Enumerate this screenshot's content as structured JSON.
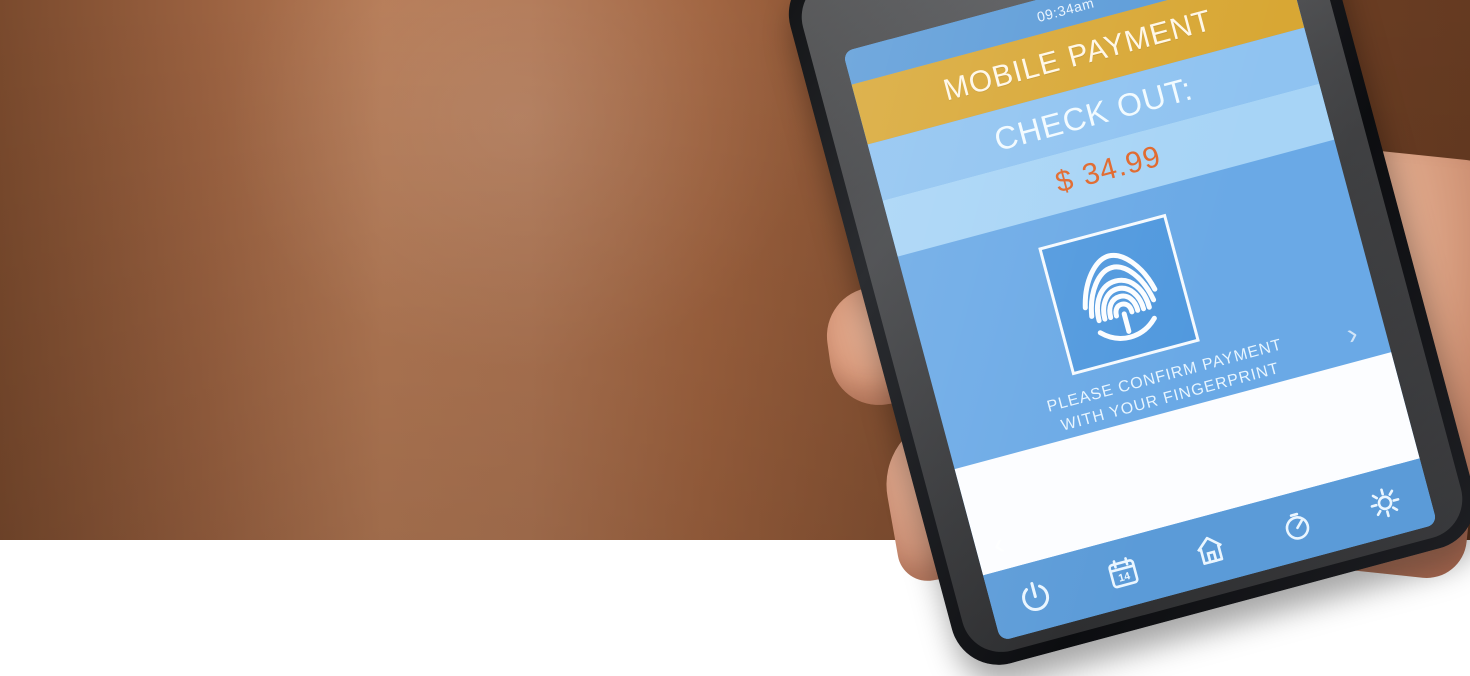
{
  "status": {
    "time": "09:34am"
  },
  "screen": {
    "banner_title": "MOBILE PAYMENT",
    "checkout_label": "CHECK OUT:",
    "amount": {
      "currency": "$",
      "value": "34.99"
    },
    "confirm_text_line1": "PLEASE CONFIRM PAYMENT",
    "confirm_text_line2": "WITH YOUR FINGERPRINT",
    "info_icon": "i",
    "calendar_day": "14"
  },
  "icons": {
    "info": "info-icon",
    "fingerprint": "fingerprint-icon",
    "power": "power-icon",
    "calendar": "calendar-icon",
    "home": "home-icon",
    "timer": "timer-icon",
    "settings": "gear-icon",
    "next": "chevron-right-icon",
    "prev": "chevron-left-icon"
  },
  "colors": {
    "accent_gold": "#d8a734",
    "screen_blue": "#6aa9e6",
    "amount_orange": "#e0672b"
  }
}
